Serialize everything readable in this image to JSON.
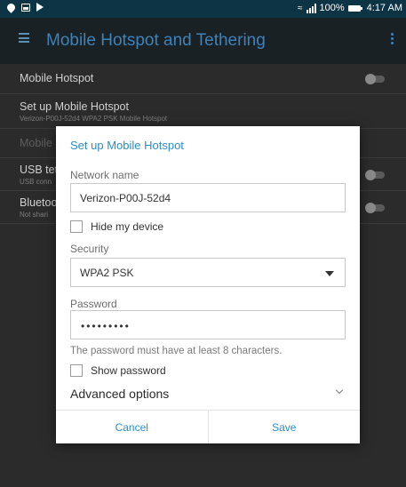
{
  "status_bar": {
    "battery": "100%",
    "time": "4:17 AM",
    "icons": [
      "location-icon",
      "image-icon",
      "play-icon",
      "wifi-icon",
      "signal-icon",
      "battery-icon"
    ]
  },
  "app_bar": {
    "title": "Mobile Hotspot and Tethering"
  },
  "settings": {
    "mobile_hotspot": {
      "title": "Mobile Hotspot"
    },
    "setup_hotspot": {
      "title": "Set up Mobile Hotspot",
      "subtitle": "Verizon-P00J-52d4 WPA2 PSK Mobile Hotspot"
    },
    "mobile_partial": {
      "title": "Mobile"
    },
    "usb_tethering": {
      "title": "USB tet",
      "subtitle": "USB conn"
    },
    "bluetooth_tethering": {
      "title": "Bluetoo",
      "subtitle": "Not shari"
    }
  },
  "dialog": {
    "title": "Set up Mobile Hotspot",
    "network_name_label": "Network name",
    "network_name_value": "Verizon-P00J-52d4",
    "hide_device_label": "Hide my device",
    "security_label": "Security",
    "security_value": "WPA2 PSK",
    "password_label": "Password",
    "password_value": "•••••••••",
    "password_helper": "The password must have at least 8 characters.",
    "show_password_label": "Show password",
    "advanced_options_label": "Advanced options",
    "cancel_label": "Cancel",
    "save_label": "Save"
  },
  "colors": {
    "accent": "#2b8ec9",
    "status_bar": "#0d3444",
    "app_bar_title": "#3f82b8"
  }
}
